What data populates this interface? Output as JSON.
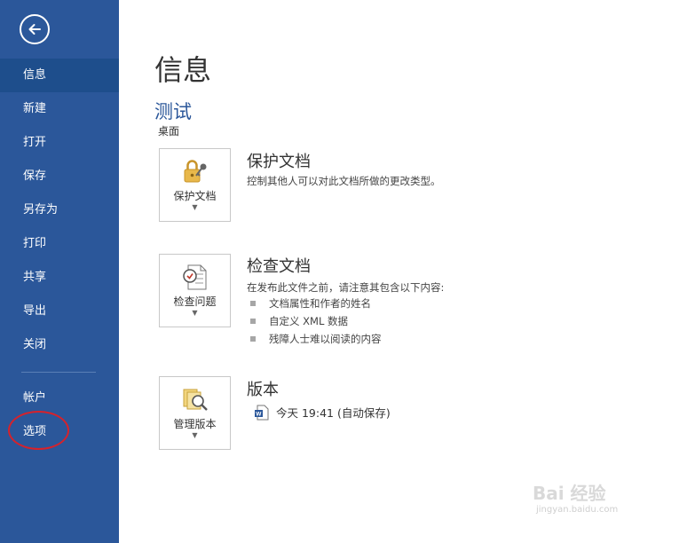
{
  "sidebar": {
    "back_icon": "arrow-left-circle-icon",
    "items": [
      {
        "label": "信息",
        "active": true
      },
      {
        "label": "新建"
      },
      {
        "label": "打开"
      },
      {
        "label": "保存"
      },
      {
        "label": "另存为"
      },
      {
        "label": "打印"
      },
      {
        "label": "共享"
      },
      {
        "label": "导出"
      },
      {
        "label": "关闭"
      }
    ],
    "bottom_items": [
      {
        "label": "帐户"
      },
      {
        "label": "选项"
      }
    ]
  },
  "main": {
    "title": "信息",
    "doc_name": "测试",
    "doc_location": "桌面",
    "sections": {
      "protect": {
        "tile_label": "保护文档",
        "icon": "lock-key-icon",
        "title": "保护文档",
        "description": "控制其他人可以对此文档所做的更改类型。"
      },
      "inspect": {
        "tile_label": "检查问题",
        "icon": "inspect-document-icon",
        "title": "检查文档",
        "description": "在发布此文件之前，请注意其包含以下内容:",
        "bullets": [
          "文档属性和作者的姓名",
          "自定义 XML 数据",
          "残障人士难以阅读的内容"
        ]
      },
      "versions": {
        "tile_label": "管理版本",
        "icon": "manage-versions-icon",
        "title": "版本",
        "entry": "今天 19:41 (自动保存)"
      }
    }
  },
  "watermark": {
    "text": "Bai 经验",
    "sub": "jingyan.baidu.com"
  },
  "colors": {
    "sidebar": "#2b579a",
    "active_item": "#1e4e8c",
    "accent": "#2b579a",
    "highlight_ring": "#d6222b"
  }
}
